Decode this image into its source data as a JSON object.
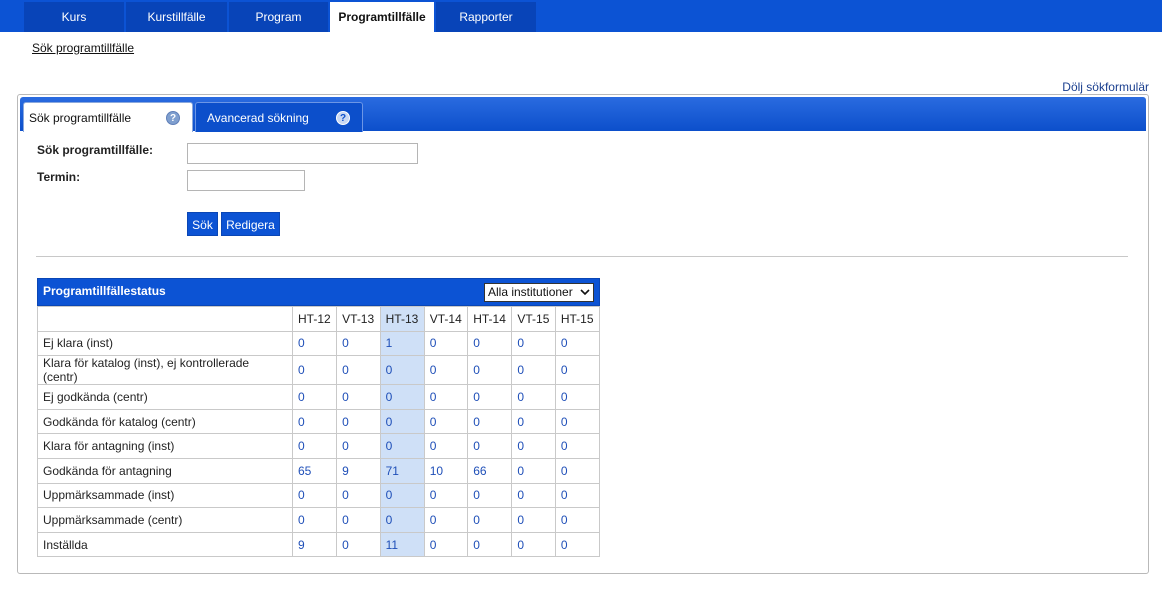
{
  "topnav": {
    "tabs": [
      {
        "label": "Kurs"
      },
      {
        "label": "Kurstillfälle"
      },
      {
        "label": "Program"
      },
      {
        "label": "Programtillfälle"
      },
      {
        "label": "Rapporter"
      }
    ],
    "active_index": 3
  },
  "subnav": {
    "link": "Sök programtillfälle"
  },
  "hide_form_link": "Dölj sökformulär",
  "search_panel": {
    "tabs": [
      {
        "label": "Sök programtillfälle",
        "help": "?"
      },
      {
        "label": "Avancerad sökning",
        "help": "?"
      }
    ],
    "fields": {
      "program_label": "Sök programtillfälle:",
      "program_value": "",
      "term_label": "Termin:",
      "term_value": ""
    },
    "buttons": {
      "search": "Sök",
      "edit": "Redigera"
    }
  },
  "status": {
    "title": "Programtillfällestatus",
    "institution_select": "Alla institutioner",
    "columns": [
      "HT-12",
      "VT-13",
      "HT-13",
      "VT-14",
      "HT-14",
      "VT-15",
      "HT-15"
    ],
    "highlight_column": 2,
    "rows": [
      {
        "label": "Ej klara (inst)",
        "values": [
          "0",
          "0",
          "1",
          "0",
          "0",
          "0",
          "0"
        ]
      },
      {
        "label": "Klara för katalog (inst), ej kontrollerade (centr)",
        "values": [
          "0",
          "0",
          "0",
          "0",
          "0",
          "0",
          "0"
        ]
      },
      {
        "label": "Ej godkända (centr)",
        "values": [
          "0",
          "0",
          "0",
          "0",
          "0",
          "0",
          "0"
        ]
      },
      {
        "label": "Godkända för katalog (centr)",
        "values": [
          "0",
          "0",
          "0",
          "0",
          "0",
          "0",
          "0"
        ]
      },
      {
        "label": "Klara för antagning (inst)",
        "values": [
          "0",
          "0",
          "0",
          "0",
          "0",
          "0",
          "0"
        ]
      },
      {
        "label": "Godkända för antagning",
        "values": [
          "65",
          "9",
          "71",
          "10",
          "66",
          "0",
          "0"
        ]
      },
      {
        "label": "Uppmärksammade (inst)",
        "values": [
          "0",
          "0",
          "0",
          "0",
          "0",
          "0",
          "0"
        ]
      },
      {
        "label": "Uppmärksammade (centr)",
        "values": [
          "0",
          "0",
          "0",
          "0",
          "0",
          "0",
          "0"
        ]
      },
      {
        "label": "Inställda",
        "values": [
          "9",
          "0",
          "11",
          "0",
          "0",
          "0",
          "0"
        ]
      }
    ]
  },
  "colors": {
    "brand_blue": "#0c53d4",
    "link_blue": "#1f4fb8",
    "highlight": "#cfe0f7"
  }
}
